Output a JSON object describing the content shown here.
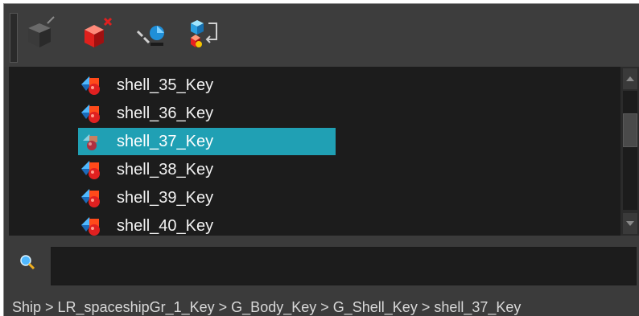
{
  "toolbar": {
    "tools": [
      {
        "icon": "add-peg-icon"
      },
      {
        "icon": "delete-peg-icon"
      },
      {
        "icon": "link-icon"
      },
      {
        "icon": "parent-icon"
      }
    ]
  },
  "list": {
    "items": [
      {
        "label": "shell_35_Key",
        "selected": false
      },
      {
        "label": "shell_36_Key",
        "selected": false
      },
      {
        "label": "shell_37_Key",
        "selected": true
      },
      {
        "label": "shell_38_Key",
        "selected": false
      },
      {
        "label": "shell_39_Key",
        "selected": false
      },
      {
        "label": "shell_40_Key",
        "selected": false
      }
    ]
  },
  "search": {
    "value": "",
    "placeholder": ""
  },
  "breadcrumb": {
    "path": "Ship > LR_spaceshipGr_1_Key > G_Body_Key > G_Shell_Key > shell_37_Key"
  },
  "colors": {
    "selection": "#20a0b4",
    "list_bg": "#1c1c1c",
    "panel_bg": "#3b3b3b"
  }
}
